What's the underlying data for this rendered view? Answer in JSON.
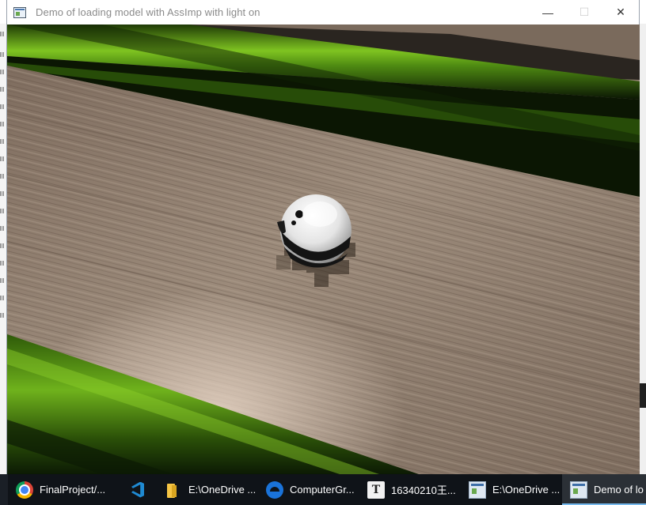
{
  "window": {
    "title": "Demo of loading model with AssImp with light on",
    "controls": {
      "minimize": "—",
      "maximize": "☐",
      "close": "✕"
    }
  },
  "scene": {
    "description_icons": [
      "bowling-ball",
      "wood-floor",
      "green-rail"
    ],
    "colors": {
      "wood_light": "#9b8a78",
      "wood_dark": "#6d5e51",
      "rail_green": "#5fa21a",
      "rail_dark": "#0c1a05",
      "ball_white": "#f2f2f2",
      "ball_black": "#121212"
    }
  },
  "taskbar": {
    "items": [
      {
        "icon": "chrome-icon",
        "label": "FinalProject/..."
      },
      {
        "icon": "vscode-icon",
        "label": ""
      },
      {
        "icon": "folder-icon",
        "label": "E:\\OneDrive ..."
      },
      {
        "icon": "edge-icon",
        "label": "ComputerGr..."
      },
      {
        "icon": "typora-icon",
        "label": "16340210王..."
      },
      {
        "icon": "window-icon",
        "label": "E:\\OneDrive ..."
      },
      {
        "icon": "window-icon",
        "label": "Demo of lo"
      }
    ]
  }
}
